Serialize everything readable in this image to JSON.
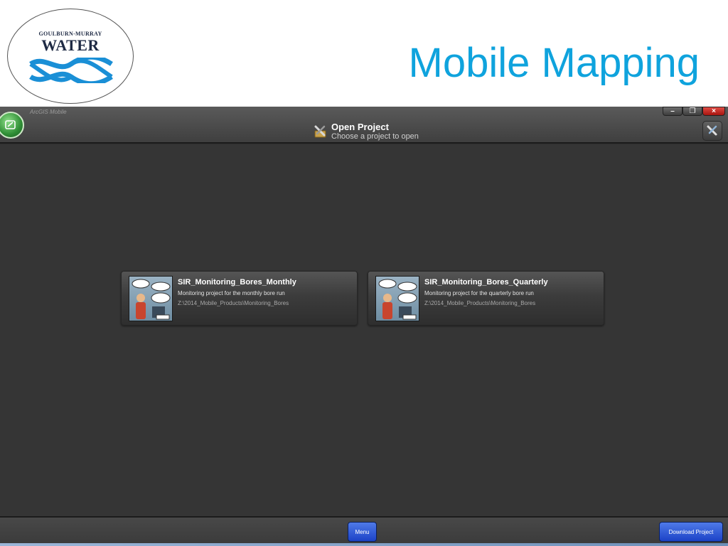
{
  "slide": {
    "title": "Mobile Mapping",
    "logo": {
      "line1": "GOULBURN-MURRAY",
      "line2": "WATER"
    }
  },
  "window": {
    "app_name": "ArcGIS Mobile",
    "controls": {
      "minimize": "–",
      "restore": "❐",
      "close": "×"
    }
  },
  "header": {
    "title": "Open Project",
    "subtitle": "Choose a project to open"
  },
  "projects": [
    {
      "name": "SIR_Monitoring_Bores_Monthly",
      "description": "Monitoring project for the monthly bore run",
      "path": "Z:\\2014_Mobile_Products\\Monitoring_Bores"
    },
    {
      "name": "SIR_Monitoring_Bores_Quarterly",
      "description": "Monitoring project for the quarterly bore run",
      "path": "Z:\\2014_Mobile_Products\\Monitoring_Bores"
    }
  ],
  "footer": {
    "menu_label": "Menu",
    "download_label": "Download Project"
  },
  "colors": {
    "title_blue": "#0fa3dd",
    "logo_navy": "#1e2a44",
    "logo_wave": "#1a8fd6",
    "button_blue": "#2a52d6",
    "background": "#353535"
  },
  "icons": {
    "app_logo": "arcgis-mobile-logo-icon",
    "header": "open-project-tools-icon",
    "settings": "settings-tools-icon"
  }
}
